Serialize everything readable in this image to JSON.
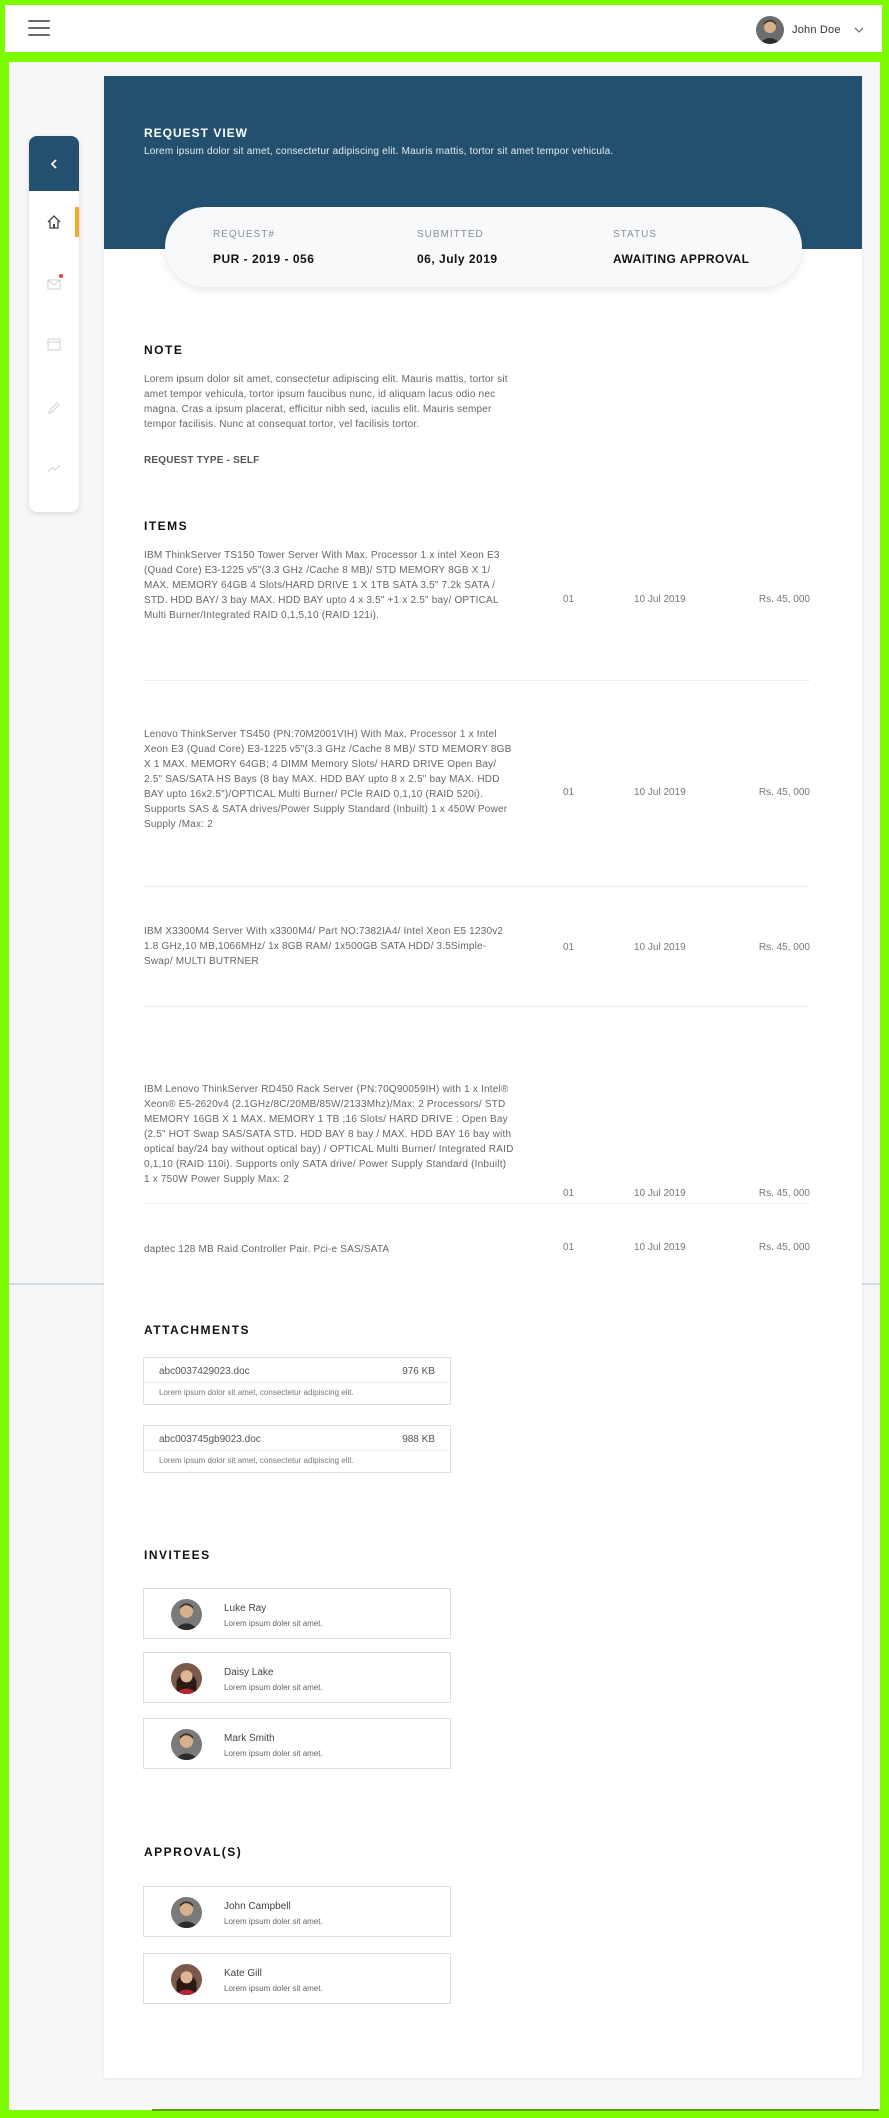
{
  "topbar": {
    "menu_icon": "hamburger-icon",
    "user_name": "John Doe",
    "user_menu_icon": "chevron-down-icon"
  },
  "sidenav": {
    "back_icon": "chevron-left-icon",
    "items": [
      {
        "icon": "home-icon",
        "active": true
      },
      {
        "icon": "mail-icon",
        "notification": true
      },
      {
        "icon": "calendar-icon"
      },
      {
        "icon": "pencil-icon"
      },
      {
        "icon": "trend-icon"
      }
    ]
  },
  "header": {
    "title": "REQUEST VIEW",
    "subtitle": "Lorem ipsum dolor sit amet, consectetur adipiscing elit. Mauris mattis, tortor sit amet tempor vehicula."
  },
  "summary": {
    "request_label": "REQUEST#",
    "request_value": "PUR - 2019 - 056",
    "submitted_label": "SUBMITTED",
    "submitted_value": "06, July 2019",
    "status_label": "STATUS",
    "status_value": "AWAITING APPROVAL"
  },
  "note": {
    "title": "NOTE",
    "text": "Lorem ipsum dolor sit amet, consectetur adipiscing elit. Mauris mattis, tortor sit amet tempor vehicula, tortor ipsum faucibus nunc, id aliquam lacus odio nec magna. Cras a ipsum placerat, efficitur nibh sed, iaculis elit. Mauris semper tempor facilisis. Nunc at consequat tortor, vel facilisis tortor.",
    "request_type": "REQUEST TYPE  - SELF"
  },
  "items": {
    "title": "ITEMS",
    "rows": [
      {
        "description": "IBM ThinkServer TS150 Tower Server With Max. Processor 1 x intel Xeon E3 (Quad Core) E3-1225 v5\"(3.3 GHz /Cache 8 MB)/ STD MEMORY 8GB X 1/ MAX. MEMORY 64GB 4 Slots/HARD DRIVE 1 X 1TB SATA 3.5\" 7.2k SATA / STD. HDD BAY/ 3 bay MAX. HDD BAY upto 4 x 3.5\" +1 x 2.5\" bay/ OPTICAL Multi Burner/Integrated RAID 0,1,5,10 (RAID 121i).",
        "qty": "01",
        "date": "10 Jul 2019",
        "price": "Rs. 45, 000"
      },
      {
        "description": "Lenovo ThinkServer TS450 (PN:70M2001VIH) With Max. Processor 1 x Intel Xeon E3 (Quad Core) E3-1225 v5\"(3.3 GHz /Cache 8 MB)/ STD MEMORY 8GB X 1 MAX. MEMORY 64GB; 4 DIMM Memory Slots/ HARD DRIVE Open Bay/ 2.5\" SAS/SATA HS Bays (8 bay MAX. HDD BAY upto 8 x 2.5\" bay MAX. HDD BAY upto 16x2.5\")/OPTICAL Multi Burner/ PCle RAID 0,1,10 (RAID 520i). Supports SAS & SATA drives/Power Supply Standard (Inbuilt) 1 x 450W Power Supply /Max: 2",
        "qty": "01",
        "date": "10 Jul 2019",
        "price": "Rs. 45, 000"
      },
      {
        "description": "IBM X3300M4 Server With x3300M4/ Part NO:7382IA4/ Intel Xeon E5 1230v2 1.8 GHz,10 MB,1066MHz/ 1x 8GB RAM/ 1x500GB SATA HDD/ 3.5Simple-Swap/ MULTI BUTRNER",
        "qty": "01",
        "date": "10 Jul 2019",
        "price": "Rs. 45, 000"
      },
      {
        "description": "IBM Lenovo ThinkServer RD450 Rack Server (PN:70Q90059IH) with 1 x Intel® Xeon® E5-2620v4 (2.1GHz/8C/20MB/85W/2133Mhz)/Max: 2 Processors/ STD MEMORY 16GB X 1 MAX. MEMORY 1 TB ;16 Slots/ HARD DRIVE : Open Bay (2.5\" HOT Swap SAS/SATA STD. HDD BAY 8 bay / MAX. HDD BAY 16 bay with optical bay/24 bay without optical bay) / OPTICAL Multi Burner/ Integrated RAID 0,1,10 (RAID 110i). Supports only SATA drive/ Power Supply Standard (Inbuilt) 1 x 750W Power Supply Max: 2",
        "qty": "01",
        "date": "10 Jul 2019",
        "price": "Rs. 45, 000"
      },
      {
        "description": "daptec 128 MB Raid Controller Pair. Pci-e SAS/SATA",
        "qty": "01",
        "date": "10 Jul 2019",
        "price": "Rs. 45, 000"
      }
    ]
  },
  "attachments": {
    "title": "ATTACHMENTS",
    "files": [
      {
        "name": "abc0037429023.doc",
        "size": "976 KB",
        "description": "Lorem ipsum dolor sit amet, consectetur adipiscing elit."
      },
      {
        "name": "abc003745gb9023.doc",
        "size": "988 KB",
        "description": "Lorem ipsum dolor sit amet, consectetur adipiscing elit."
      }
    ]
  },
  "invitees": {
    "title": "INVITEES",
    "people": [
      {
        "name": "Luke Ray",
        "description": "Lorem ipsum doler sit amet."
      },
      {
        "name": "Daisy Lake",
        "description": "Lorem ipsum doler sit amet."
      },
      {
        "name": "Mark Smith",
        "description": "Lorem ipsum doler sit amet."
      }
    ]
  },
  "approvals": {
    "title": "APPROVAL(S)",
    "people": [
      {
        "name": "John Campbell",
        "description": "Lorem ipsum doler sit amet."
      },
      {
        "name": "Kate Gill",
        "description": "Lorem ipsum doler sit amet."
      }
    ]
  },
  "colors": {
    "brand": "#23506f",
    "accent": "#f6a623",
    "notification": "#e64545",
    "frame": "#7dfc00"
  }
}
